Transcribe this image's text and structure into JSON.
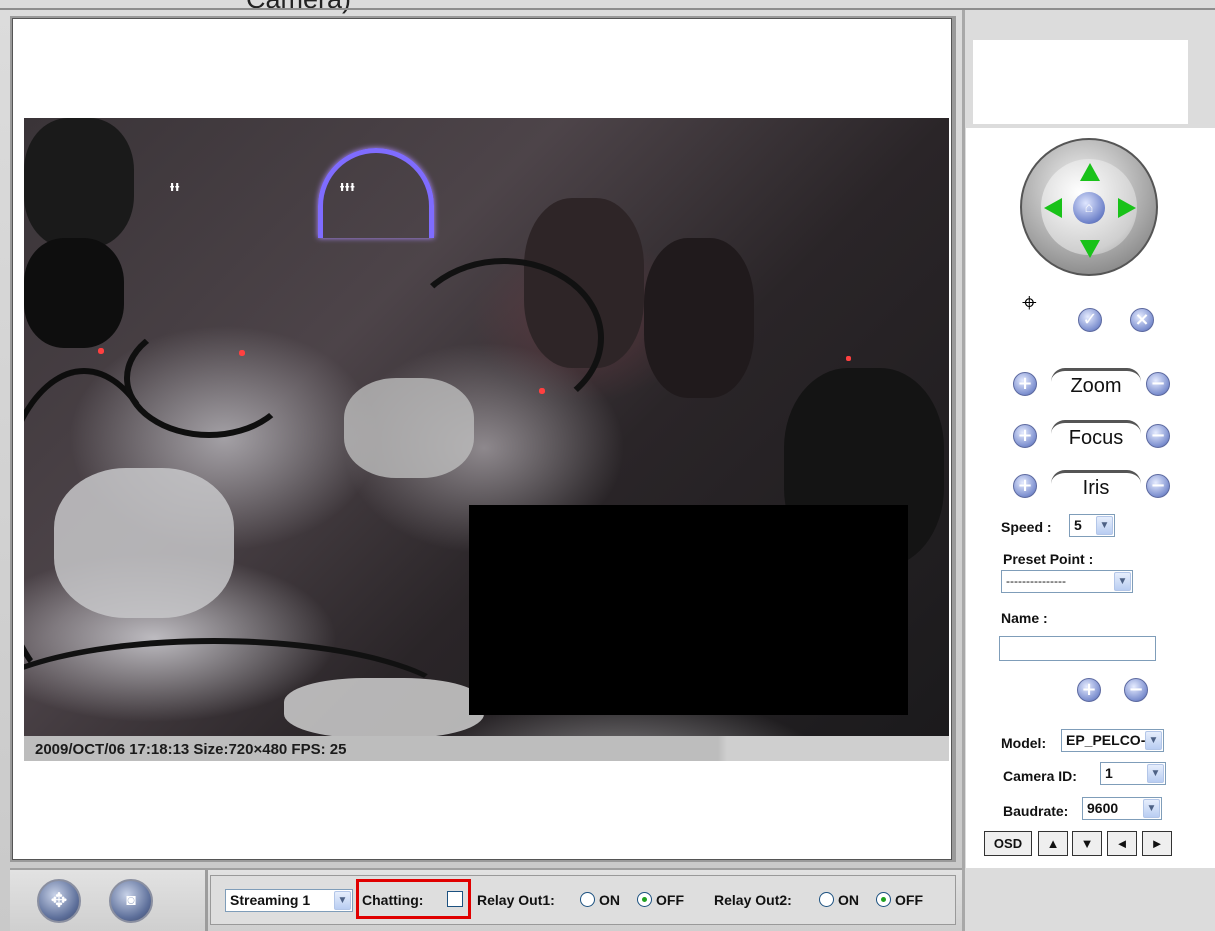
{
  "top_caption": "Camera)",
  "video": {
    "osd_text": "2009/OCT/06 17:18:13 Size:720×480 FPS: 25",
    "neon_text_left": "ᵻᵻ",
    "neon_text_right": "ᵻᵻᵻ"
  },
  "bottom_bar": {
    "left_button_icon": "joystick-icon",
    "right_button_icon": "camera-icon",
    "stream_select": "Streaming 1",
    "chatting_label": "Chatting:",
    "relay_out1_label": "Relay Out1:",
    "relay_out2_label": "Relay Out2:",
    "on_label": "ON",
    "off_label": "OFF",
    "relay_out1_state": "OFF",
    "relay_out2_state": "OFF"
  },
  "ptz": {
    "zoom_label": "Zoom",
    "focus_label": "Focus",
    "iris_label": "Iris",
    "speed_label": "Speed :",
    "speed_value": "5",
    "preset_label": "Preset Point :",
    "preset_value": "---------------",
    "name_label": "Name :",
    "name_value": "",
    "model_label": "Model:",
    "model_value": "EP_PELCO-",
    "camera_id_label": "Camera ID:",
    "camera_id_value": "1",
    "baudrate_label": "Baudrate:",
    "baudrate_value": "9600",
    "osd_button": "OSD",
    "plus_glyph": "+",
    "minus_glyph": "−",
    "up_glyph": "▲",
    "down_glyph": "▼",
    "left_glyph": "◄",
    "right_glyph": "►"
  },
  "colors": {
    "accent_green": "#19c219",
    "highlight_red": "#e00000"
  }
}
